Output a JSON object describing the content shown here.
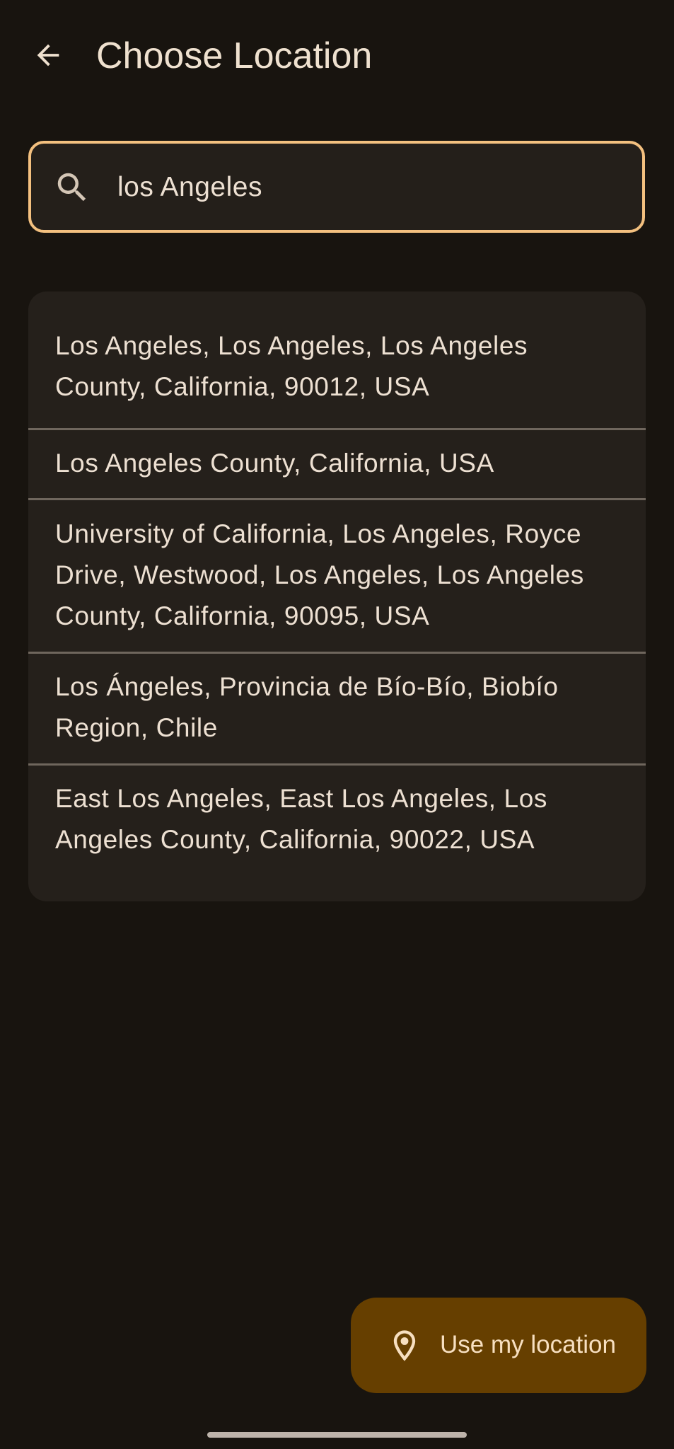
{
  "header": {
    "title": "Choose Location",
    "back_icon": "arrow-back-icon"
  },
  "search": {
    "value": "los Angeles",
    "icon": "search-icon",
    "border_color": "#f3c07f"
  },
  "results": [
    {
      "line1": "Los Angeles, Los Angeles, Los Angeles",
      "line2": "County, California, 90012, USA"
    },
    {
      "line1": "Los Angeles County, California, USA"
    },
    {
      "line1": "University of California, Los Angeles, Royce",
      "line2": "Drive, Westwood, Los Angeles, Los Angeles",
      "line3": "County, California, 90095, USA"
    },
    {
      "line1": "Los Ángeles, Provincia de Bío-Bío, Biobío",
      "line2": "Region, Chile"
    },
    {
      "line1": "East Los Angeles, East Los Angeles, Los",
      "line2": "Angeles County, California, 90022, USA"
    }
  ],
  "fab": {
    "label": "Use my location",
    "icon": "location-pin-icon",
    "color": "#663f00"
  },
  "colors": {
    "background": "#18140f",
    "surface": "#25201b",
    "text": "#ede0d2"
  }
}
